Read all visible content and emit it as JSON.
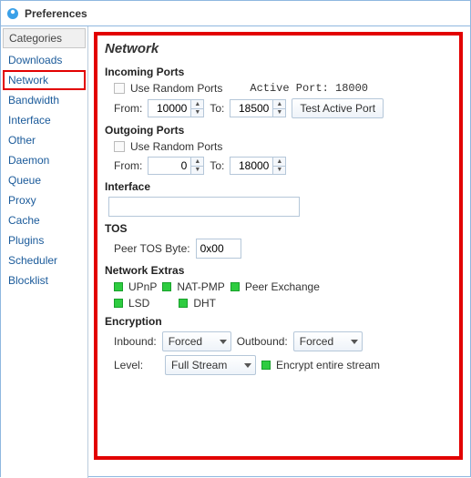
{
  "window": {
    "title": "Preferences"
  },
  "sidebar": {
    "header": "Categories",
    "items": [
      {
        "label": "Downloads",
        "selected": false
      },
      {
        "label": "Network",
        "selected": true
      },
      {
        "label": "Bandwidth",
        "selected": false
      },
      {
        "label": "Interface",
        "selected": false
      },
      {
        "label": "Other",
        "selected": false
      },
      {
        "label": "Daemon",
        "selected": false
      },
      {
        "label": "Queue",
        "selected": false
      },
      {
        "label": "Proxy",
        "selected": false
      },
      {
        "label": "Cache",
        "selected": false
      },
      {
        "label": "Plugins",
        "selected": false
      },
      {
        "label": "Scheduler",
        "selected": false
      },
      {
        "label": "Blocklist",
        "selected": false
      }
    ]
  },
  "page": {
    "title": "Network",
    "incoming": {
      "heading": "Incoming Ports",
      "random_label": "Use Random Ports",
      "active_port_label": "Active Port:",
      "active_port_value": "18000",
      "from_label": "From:",
      "from_value": "10000",
      "to_label": "To:",
      "to_value": "18500",
      "test_button": "Test Active Port"
    },
    "outgoing": {
      "heading": "Outgoing Ports",
      "random_label": "Use Random Ports",
      "from_label": "From:",
      "from_value": "0",
      "to_label": "To:",
      "to_value": "18000"
    },
    "interface": {
      "heading": "Interface",
      "value": ""
    },
    "tos": {
      "heading": "TOS",
      "label": "Peer TOS Byte:",
      "value": "0x00"
    },
    "extras": {
      "heading": "Network Extras",
      "items": [
        "UPnP",
        "NAT-PMP",
        "Peer Exchange",
        "LSD",
        "DHT"
      ]
    },
    "encryption": {
      "heading": "Encryption",
      "inbound_label": "Inbound:",
      "inbound_value": "Forced",
      "outbound_label": "Outbound:",
      "outbound_value": "Forced",
      "level_label": "Level:",
      "level_value": "Full Stream",
      "entire_label": "Encrypt entire stream"
    }
  }
}
